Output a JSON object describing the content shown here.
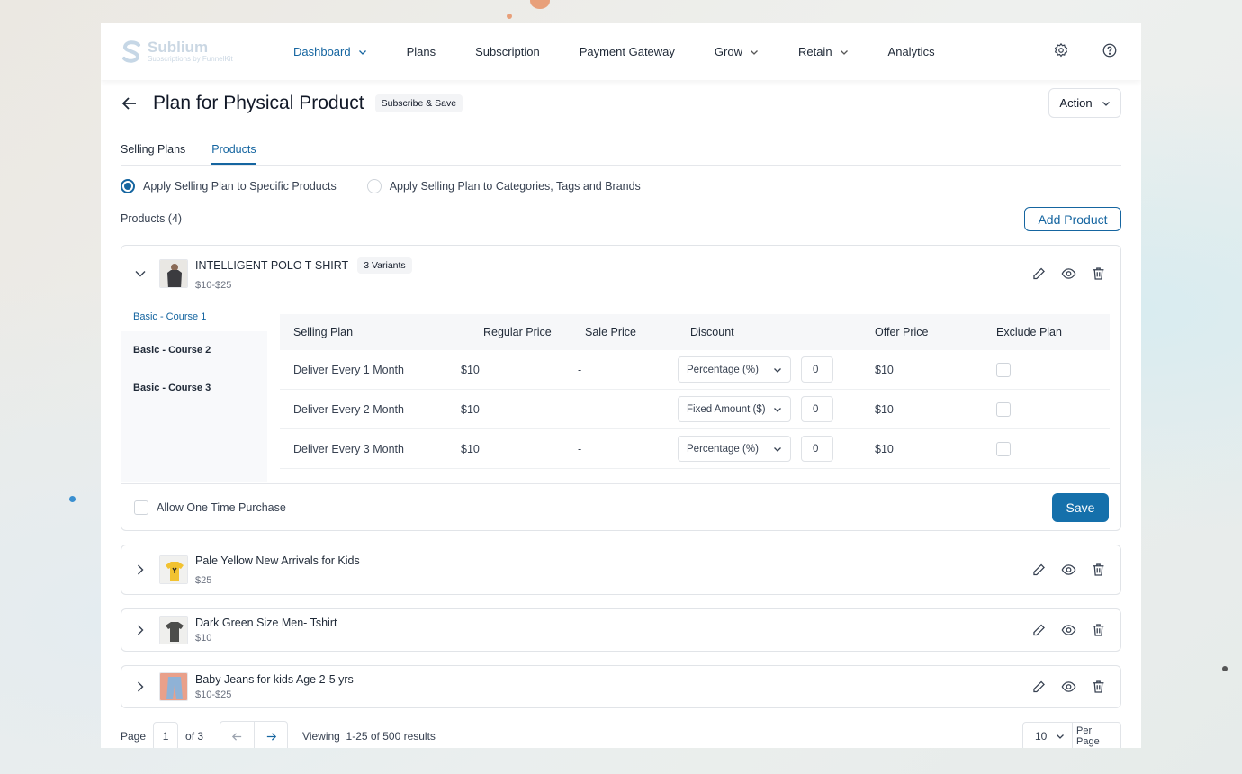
{
  "brand": {
    "name": "Sublium",
    "tagline": "Subscriptions by FunnelKit"
  },
  "nav": {
    "items": [
      {
        "label": "Dashboard",
        "has_dropdown": true,
        "active": true
      },
      {
        "label": "Plans",
        "has_dropdown": false
      },
      {
        "label": "Subscription",
        "has_dropdown": false
      },
      {
        "label": "Payment Gateway",
        "has_dropdown": false
      },
      {
        "label": "Grow",
        "has_dropdown": true
      },
      {
        "label": "Retain",
        "has_dropdown": true
      },
      {
        "label": "Analytics",
        "has_dropdown": false
      }
    ],
    "right_icons": [
      "gear-icon",
      "help-circle-icon"
    ]
  },
  "header": {
    "title": "Plan for Physical Product",
    "badge": "Subscribe & Save",
    "action_label": "Action"
  },
  "tabs": [
    {
      "label": "Selling Plans"
    },
    {
      "label": "Products",
      "active": true
    }
  ],
  "apply_options": [
    {
      "label": "Apply Selling Plan to Specific Products",
      "checked": true
    },
    {
      "label": "Apply Selling Plan to Categories, Tags and Brands",
      "checked": false
    }
  ],
  "products_count_label": "Products (4)",
  "add_product_label": "Add Product",
  "expanded_product": {
    "name": "INTELLIGENT POLO T-SHIRT",
    "variants_badge": "3 Variants",
    "price": "$10-$25",
    "variants": [
      {
        "label": "Basic - Course 1",
        "active": true
      },
      {
        "label": "Basic - Course 2"
      },
      {
        "label": "Basic - Course 3"
      }
    ],
    "table_headers": [
      "Selling Plan",
      "Regular Price",
      "Sale Price",
      "Discount",
      "Offer Price",
      "Exclude Plan"
    ],
    "rows": [
      {
        "plan": "Deliver Every 1 Month",
        "regular": "$10",
        "sale": "-",
        "discount_type": "Percentage (%)",
        "discount_value": "0",
        "offer": "$10"
      },
      {
        "plan": "Deliver Every 2 Month",
        "regular": "$10",
        "sale": "-",
        "discount_type": "Fixed Amount ($)",
        "discount_value": "0",
        "offer": "$10"
      },
      {
        "plan": "Deliver Every 3 Month",
        "regular": "$10",
        "sale": "-",
        "discount_type": "Percentage (%)",
        "discount_value": "0",
        "offer": "$10"
      }
    ],
    "allow_one_time_label": "Allow One Time Purchase",
    "save_label": "Save"
  },
  "collapsed_products": [
    {
      "name": "Pale Yellow New Arrivals for Kids",
      "price": "$25"
    },
    {
      "name": "Dark Green Size Men- Tshirt",
      "price": "$10"
    },
    {
      "name": "Baby Jeans for kids Age 2-5 yrs",
      "price": "$10-$25"
    }
  ],
  "pagination": {
    "page_label": "Page",
    "current_page": "1",
    "of_label": "of 3",
    "viewing_label": "Viewing  1-25 of 500 results",
    "per_page_value": "10",
    "per_page_label": "Per Page"
  },
  "colors": {
    "accent": "#1565a0",
    "save_button": "#1570ab"
  }
}
